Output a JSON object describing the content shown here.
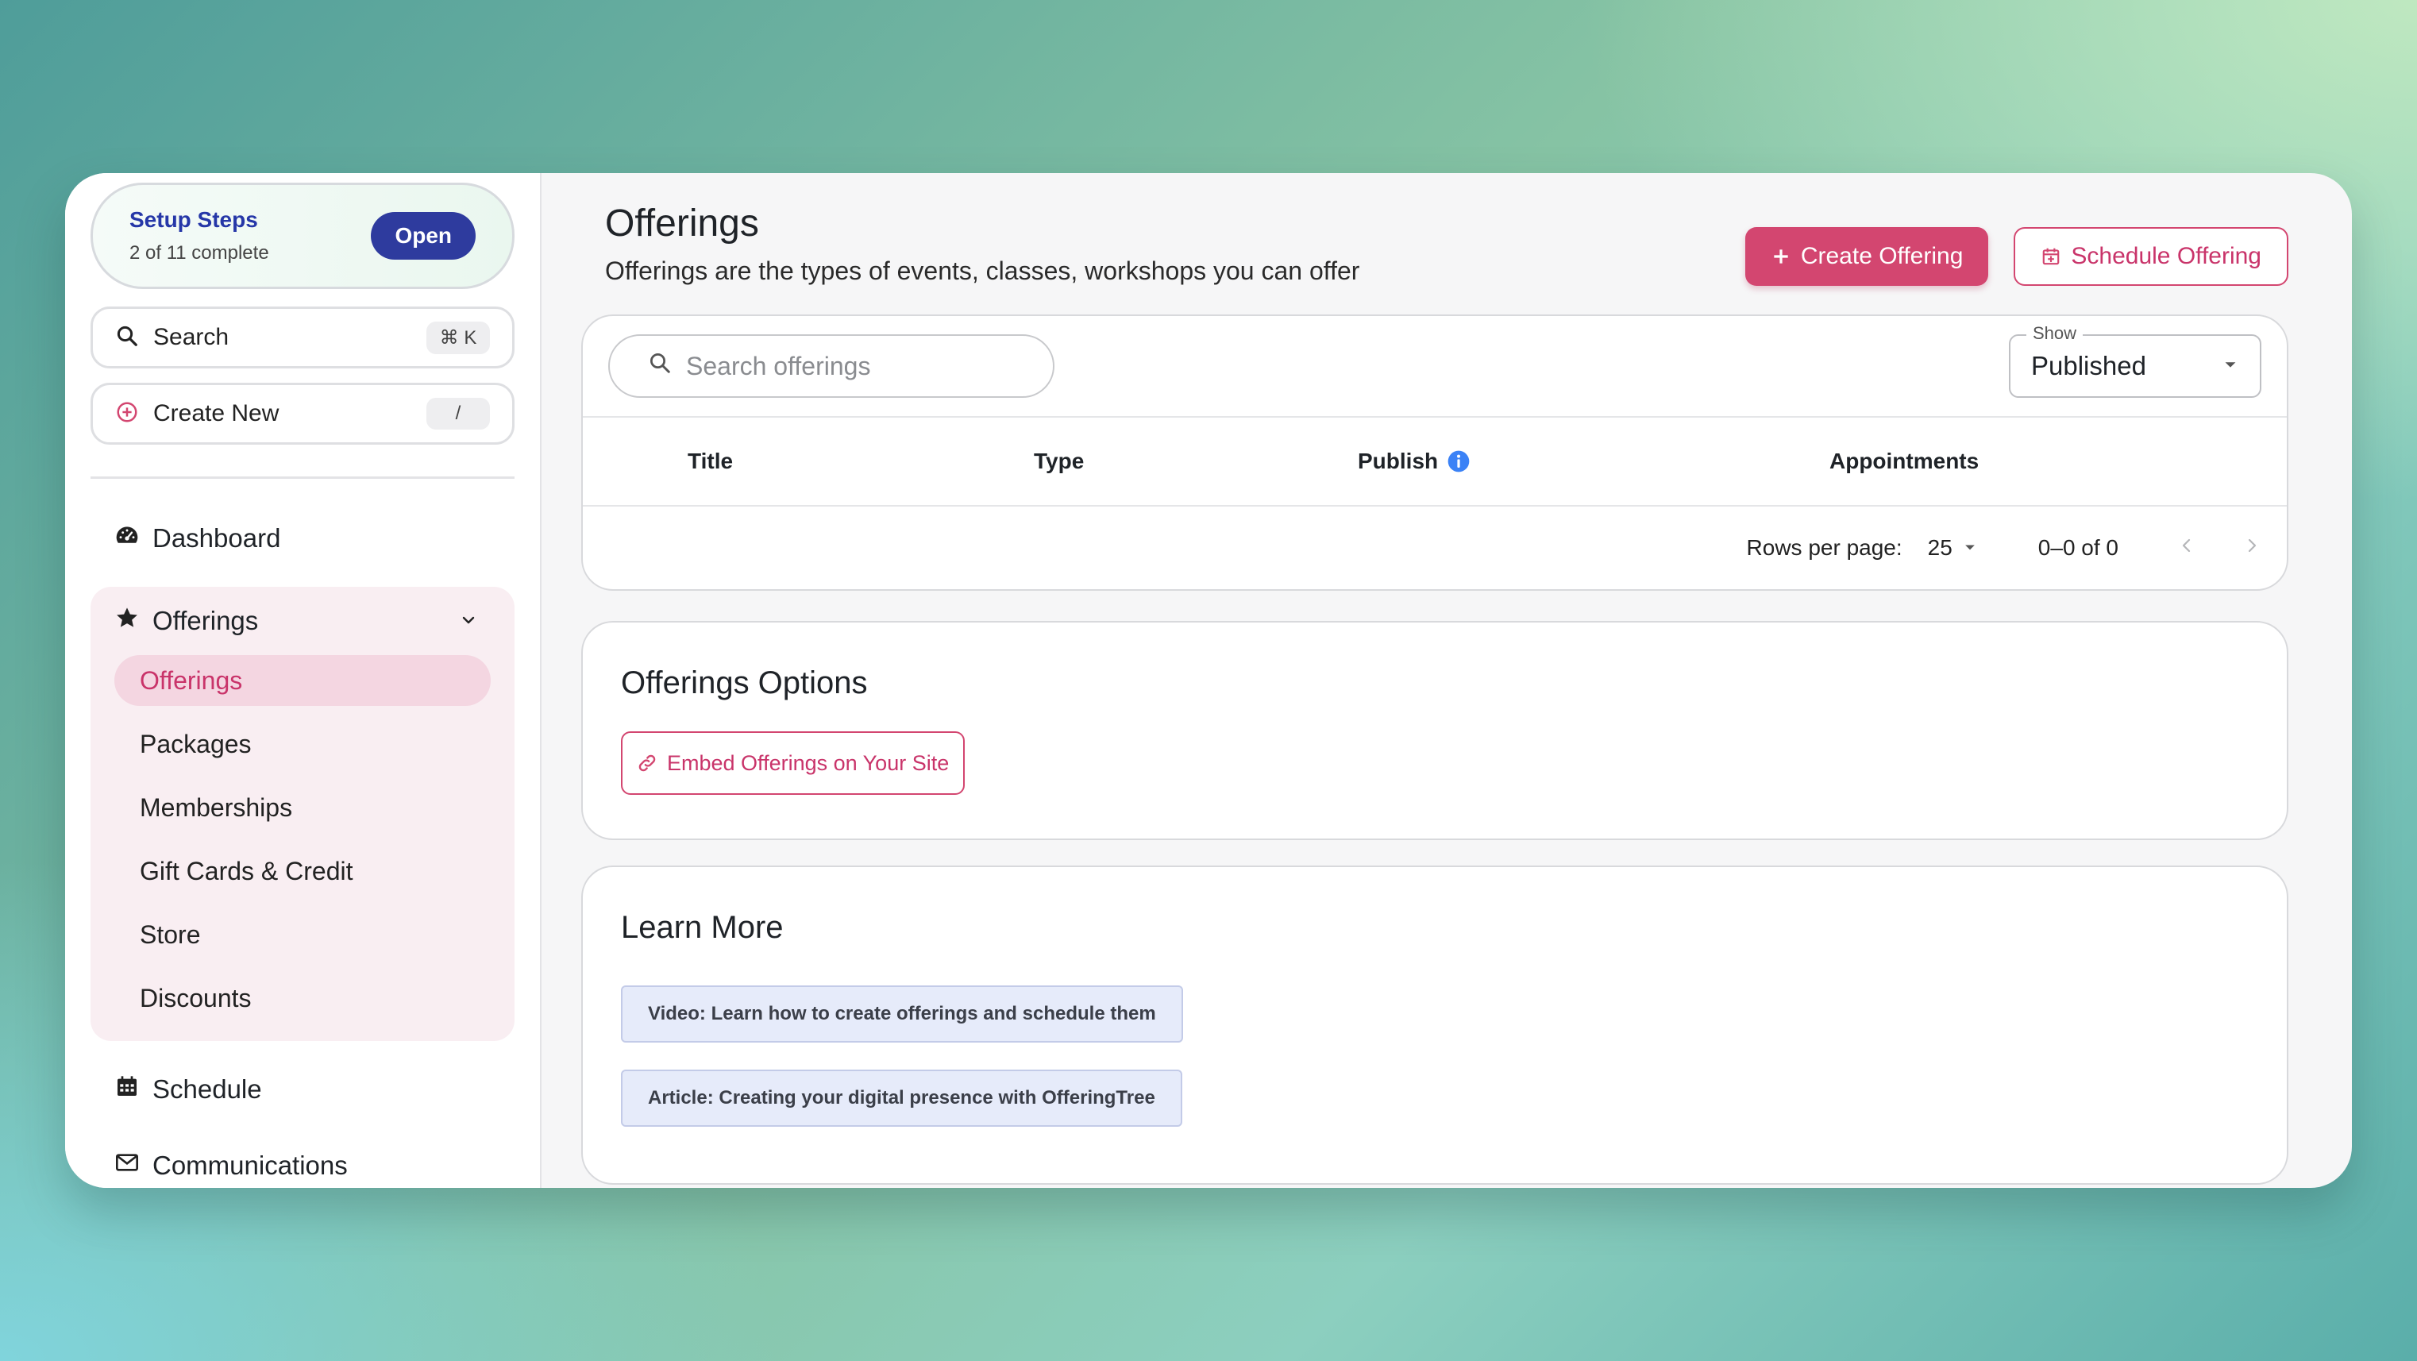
{
  "sidebar": {
    "setup": {
      "title": "Setup Steps",
      "progress": "2 of 11 complete",
      "open_label": "Open"
    },
    "search": {
      "label": "Search",
      "shortcut": "⌘ K"
    },
    "create_new": {
      "label": "Create New",
      "shortcut": "/"
    },
    "dashboard_label": "Dashboard",
    "offerings_group": {
      "label": "Offerings",
      "items": [
        {
          "label": "Offerings",
          "active": true
        },
        {
          "label": "Packages"
        },
        {
          "label": "Memberships"
        },
        {
          "label": "Gift Cards & Credit"
        },
        {
          "label": "Store"
        },
        {
          "label": "Discounts"
        }
      ]
    },
    "schedule_label": "Schedule",
    "communications_label": "Communications"
  },
  "header": {
    "title": "Offerings",
    "subtitle": "Offerings are the types of events, classes, workshops you can offer",
    "create_label": "Create Offering",
    "schedule_label": "Schedule Offering"
  },
  "table": {
    "search_placeholder": "Search offerings",
    "filter_legend": "Show",
    "filter_value": "Published",
    "columns": [
      "Title",
      "Type",
      "Publish",
      "Appointments"
    ],
    "rows_per_page_label": "Rows per page:",
    "rows_per_page_value": "25",
    "range": "0–0 of 0"
  },
  "options": {
    "title": "Offerings Options",
    "embed_label": "Embed Offerings on Your Site"
  },
  "learn_more": {
    "title": "Learn More",
    "links": [
      "Video: Learn how to create offerings and schedule them",
      "Article: Creating your digital presence with OfferingTree"
    ]
  },
  "colors": {
    "accent": "#d34670",
    "brand_blue": "#2e3b9e",
    "info_blue": "#3b82f6"
  }
}
